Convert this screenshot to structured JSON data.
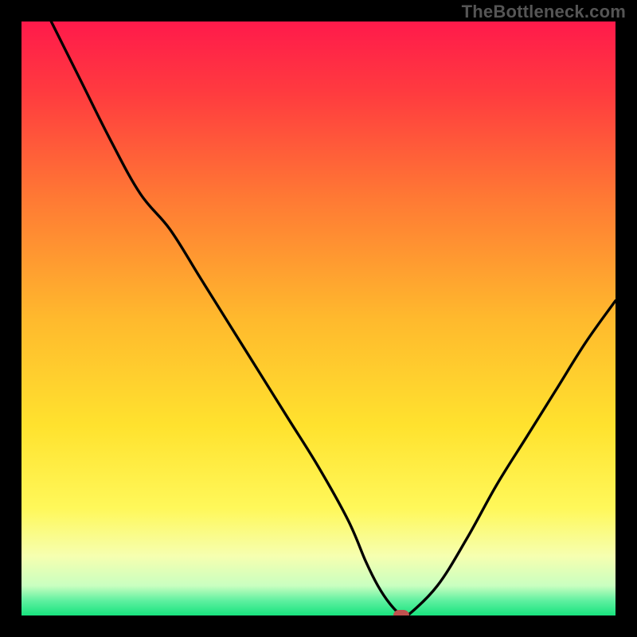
{
  "attribution": "TheBottleneck.com",
  "colors": {
    "frame": "#000000",
    "gradient_stops": [
      {
        "offset": 0.0,
        "color": "#ff1a4b"
      },
      {
        "offset": 0.12,
        "color": "#ff3b3f"
      },
      {
        "offset": 0.3,
        "color": "#ff7a34"
      },
      {
        "offset": 0.5,
        "color": "#ffb92d"
      },
      {
        "offset": 0.68,
        "color": "#ffe22e"
      },
      {
        "offset": 0.82,
        "color": "#fff85a"
      },
      {
        "offset": 0.9,
        "color": "#f6ffb0"
      },
      {
        "offset": 0.95,
        "color": "#c9ffc0"
      },
      {
        "offset": 0.975,
        "color": "#5ff0a0"
      },
      {
        "offset": 1.0,
        "color": "#18e37e"
      }
    ],
    "curve": "#000000",
    "marker": "#c0524f"
  },
  "chart_data": {
    "type": "line",
    "title": "",
    "xlabel": "",
    "ylabel": "",
    "xlim": [
      0,
      100
    ],
    "ylim": [
      0,
      100
    ],
    "grid": false,
    "legend": false,
    "series": [
      {
        "name": "bottleneck-curve",
        "x": [
          5,
          10,
          15,
          20,
          25,
          30,
          35,
          40,
          45,
          50,
          55,
          58,
          60,
          62,
          64,
          65,
          70,
          75,
          80,
          85,
          90,
          95,
          100
        ],
        "y": [
          100,
          90,
          80,
          71,
          65,
          57,
          49,
          41,
          33,
          25,
          16,
          9,
          5,
          2,
          0,
          0,
          5,
          13,
          22,
          30,
          38,
          46,
          53
        ]
      }
    ],
    "annotations": [
      {
        "name": "optimal-marker",
        "x": 64,
        "y": 0
      }
    ]
  }
}
